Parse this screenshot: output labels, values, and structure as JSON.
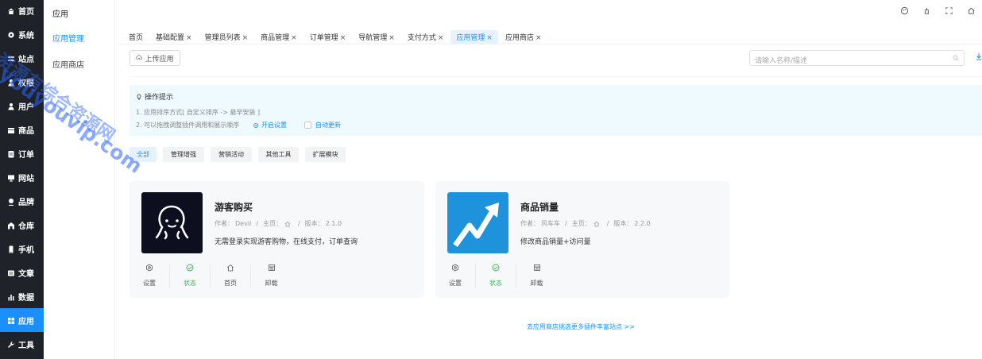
{
  "nav": {
    "items": [
      {
        "label": "首页",
        "icon": "home-icon"
      },
      {
        "label": "系统",
        "icon": "gear-icon"
      },
      {
        "label": "站点",
        "icon": "sliders-icon"
      },
      {
        "label": "权限",
        "icon": "user-shield-icon"
      },
      {
        "label": "用户",
        "icon": "user-icon"
      },
      {
        "label": "商品",
        "icon": "box-icon"
      },
      {
        "label": "订单",
        "icon": "order-icon"
      },
      {
        "label": "网站",
        "icon": "monitor-icon"
      },
      {
        "label": "品牌",
        "icon": "brand-icon"
      },
      {
        "label": "仓库",
        "icon": "warehouse-icon"
      },
      {
        "label": "手机",
        "icon": "phone-icon"
      },
      {
        "label": "文章",
        "icon": "article-icon"
      },
      {
        "label": "数据",
        "icon": "bar-chart-icon"
      },
      {
        "label": "应用",
        "icon": "apps-icon"
      },
      {
        "label": "工具",
        "icon": "wrench-icon"
      }
    ],
    "active_index": 13
  },
  "submenu": {
    "title": "应用",
    "items": [
      "应用管理",
      "应用商店"
    ]
  },
  "tabs": [
    {
      "label": "首页",
      "closable": false
    },
    {
      "label": "基础配置",
      "closable": true
    },
    {
      "label": "管理员列表",
      "closable": true
    },
    {
      "label": "商品管理",
      "closable": true
    },
    {
      "label": "订单管理",
      "closable": true
    },
    {
      "label": "导航管理",
      "closable": true
    },
    {
      "label": "支付方式",
      "closable": true
    },
    {
      "label": "应用管理",
      "closable": true,
      "active": true
    },
    {
      "label": "应用商店",
      "closable": true
    }
  ],
  "toolbar": {
    "upload_label": "上传应用",
    "search_placeholder": "请输入名称/描述"
  },
  "tip": {
    "title": "操作提示",
    "line1": "1. 应用排序方式[ 自定义排序 -> 最早安装 ]",
    "line2": "2. 可以拖拽调整插件调用和展示顺序",
    "link": "开启设置",
    "checkbox_label": "自动更新"
  },
  "filters": [
    "全部",
    "管理增强",
    "营销活动",
    "其他工具",
    "扩展模块"
  ],
  "cards": [
    {
      "name": "游客购买",
      "author_label": "作者：",
      "author": "Devil",
      "home_label": "主页：",
      "version_label": "版本：",
      "version": "2.1.0",
      "desc": "无需登录实现游客购物，在线支付，订单查询",
      "thumb_color": "#0d0f1e",
      "actions": [
        "设置",
        "状态",
        "首页",
        "卸载"
      ]
    },
    {
      "name": "商品销量",
      "author_label": "作者：",
      "author": "风车车",
      "home_label": "主页：",
      "version_label": "版本：",
      "version": "2.2.0",
      "desc": "修改商品销量+访问量",
      "thumb_color": "#1e93dc",
      "actions": [
        "设置",
        "状态",
        "卸载"
      ]
    }
  ],
  "more_link": "去应用商店挑选更多插件丰富站点 >>",
  "watermark": {
    "line1": "资源有综合资源网",
    "line2": "youyouvip.com"
  },
  "colors": {
    "accent": "#1a90ff",
    "nav_bg": "#1f2329",
    "status_green": "#3cb65c",
    "tip_bg": "#eefafd"
  }
}
